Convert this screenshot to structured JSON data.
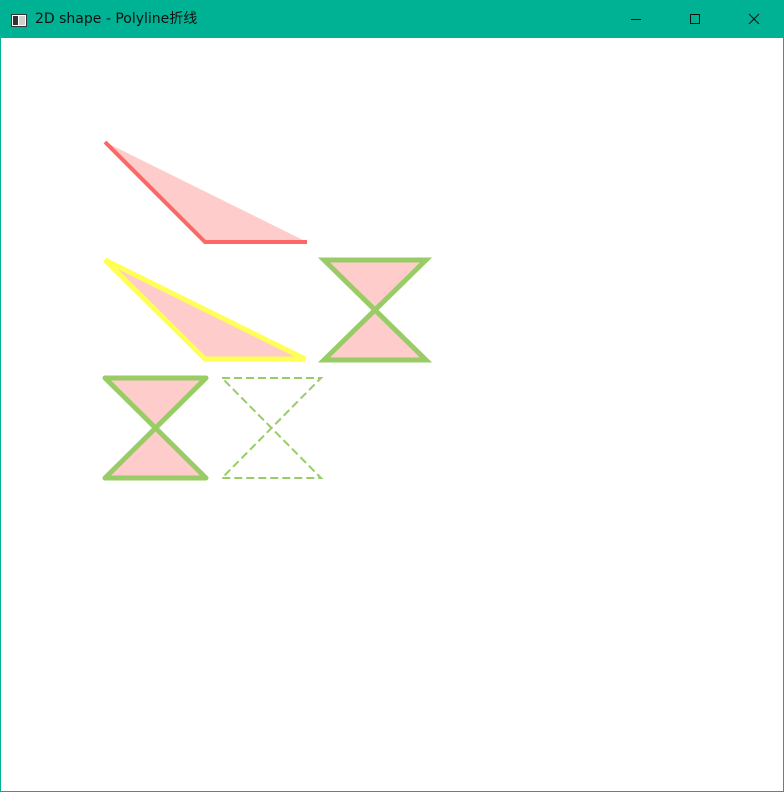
{
  "window": {
    "title": "2D shape - Polyline折线",
    "accent_color": "#00b294",
    "background": "#ffffff"
  },
  "titlebar": {
    "app_icon": "window-app-icon",
    "buttons": [
      {
        "name": "minimize-button",
        "icon": "minimize-icon"
      },
      {
        "name": "maximize-button",
        "icon": "maximize-icon"
      },
      {
        "name": "close-button",
        "icon": "close-icon"
      }
    ]
  },
  "shapes": {
    "colors": {
      "fill": "#ffcccc",
      "red_stroke": "#ff6666",
      "yellow_stroke": "#ffff55",
      "green_stroke": "#99cc66"
    },
    "items": [
      {
        "id": "polyline-red-triangle",
        "type": "polyline",
        "stroke": "red",
        "filled": true,
        "dashed": false
      },
      {
        "id": "polyline-yellow-triangle",
        "type": "polyline",
        "stroke": "yellow",
        "filled": true,
        "dashed": false
      },
      {
        "id": "polyline-hourglass-right",
        "type": "polyline",
        "stroke": "green",
        "filled": true,
        "dashed": false
      },
      {
        "id": "polyline-hourglass-left",
        "type": "polyline",
        "stroke": "green",
        "filled": true,
        "dashed": false
      },
      {
        "id": "polyline-hourglass-dashed",
        "type": "polyline",
        "stroke": "green",
        "filled": false,
        "dashed": true
      }
    ]
  }
}
